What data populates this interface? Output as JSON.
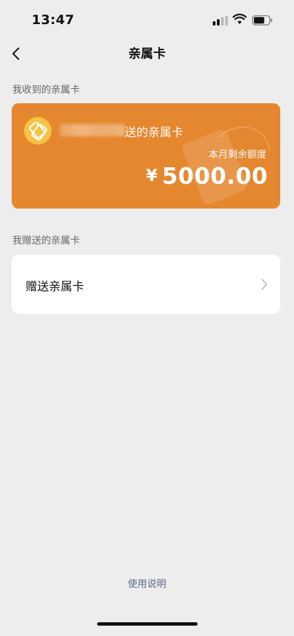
{
  "status_bar": {
    "time": "13:47"
  },
  "nav": {
    "title": "亲属卡"
  },
  "received_section": {
    "label": "我收到的亲属卡",
    "card": {
      "title_suffix": "送的亲属卡",
      "balance_label": "本月剩余额度",
      "currency": "¥",
      "balance": "5000.00"
    }
  },
  "given_section": {
    "label": "我赠送的亲属卡",
    "gift_label": "赠送亲属卡"
  },
  "footer": {
    "usage_link": "使用说明"
  },
  "colors": {
    "card_orange": "#e5872f",
    "logo_yellow": "#f6c343",
    "link_blue": "#5b6a91",
    "background": "#ededed"
  }
}
